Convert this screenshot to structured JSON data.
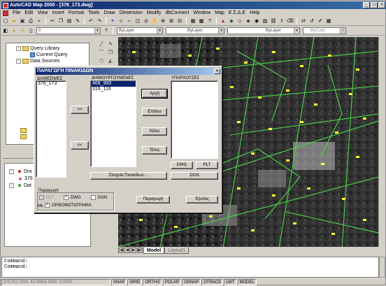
{
  "window": {
    "title": "AutoCAD Map 2000 - [376_173.dwg]"
  },
  "menu": [
    "File",
    "Edit",
    "View",
    "Insert",
    "Format",
    "Tools",
    "Draw",
    "Dimension",
    "Modify",
    "dbConnect",
    "Window",
    "Map",
    "Ε.Σ.Δ.Ε",
    "Help"
  ],
  "toolbar": {
    "layer_value": "0",
    "color_value": "ByLayer",
    "linetype_value": "ByLayer",
    "lineweight_value": "ByLayer",
    "plotstyle_value": "ByColor"
  },
  "workspace": {
    "items": [
      {
        "label": "Query Library",
        "expander": "-"
      },
      {
        "label": "Current Query"
      },
      {
        "label": "Data Sources",
        "expander": "-"
      }
    ]
  },
  "lower_panel": {
    "items": [
      "Dra",
      "376",
      "Dat"
    ]
  },
  "dialog": {
    "title": "ΠΑΡΑΓΩΓΗ ΠΙΝΑΚΙΔΩΝ",
    "available_label": "ΔΙΑΘΕΣΙΜΕΣ",
    "created_label": "ΔΗΜΙΟΥΡΓΟΥΜΕΝΕΣ",
    "existing_label": "ΥΠΑΡΧΟΥΣΕΣ",
    "available_items": [
      "376_173"
    ],
    "created_items": [
      {
        "label": "468_900",
        "selected": true
      },
      {
        "label": "316_116",
        "selected": false
      }
    ],
    "existing_items": [],
    "add_button": ">>",
    "remove_button": "<<",
    "start_button": "Αρχή",
    "prev_button": "Επάνω",
    "next_button": "Κάτω",
    "end_button": "Τέλος",
    "dwg_button": "DWG",
    "plt_button": "PLT",
    "dgn_button": "DGN",
    "sheet_info_button": "Στοιχεία Πινακίδων ...",
    "production_group": "Παραγωγή",
    "plt_check": {
      "label": "PLT",
      "checked": false,
      "disabled": true
    },
    "dwg_check": {
      "label": "DWG",
      "checked": true
    },
    "dgn_check": {
      "label": "DGN",
      "checked": false
    },
    "ortho_prefix": "Με",
    "ortho_check": {
      "label": "ΟΡΘΟΦΩΤΟΓΡΑΦΙΑ",
      "checked": true
    },
    "produce_button": "Παραγωγή",
    "exit_button": "Έξοδος",
    "close_glyph": "×"
  },
  "layout_tabs": [
    "Model",
    "Layout1"
  ],
  "command": {
    "line1": "Command:",
    "line2": "Command:"
  },
  "status": {
    "coords": "375752.7000, 4174054.3000, 0.0000",
    "toggles": [
      "SNAP",
      "GRID",
      "ORTHO",
      "POLAR",
      "OSNAP",
      "OTRACK",
      "LWT",
      "MODEL"
    ]
  },
  "colors": {
    "title_bar": "#0a246a",
    "parcel_lines": "#48d848",
    "labels": "#ffff30"
  }
}
